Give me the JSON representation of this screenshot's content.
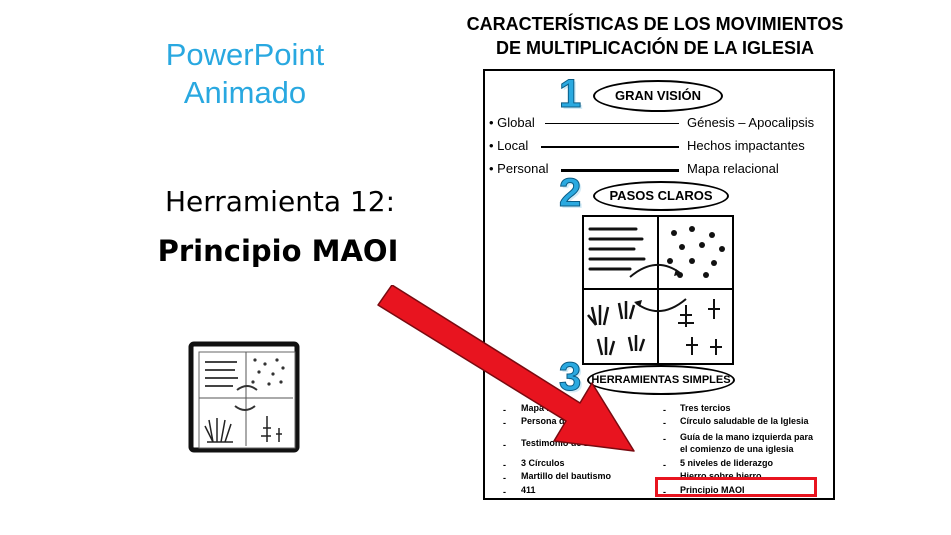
{
  "left": {
    "powerpoint_line1": "PowerPoint",
    "powerpoint_line2": "Animado",
    "tool_line": "Herramienta 12:",
    "principle_title": "Principio MAOI",
    "icon": "four-fields-icon"
  },
  "document": {
    "title_line1": "CARACTERÍSTICAS DE LOS MOVIMIENTOS",
    "title_line2": "DE MULTIPLICACIÓN DE LA IGLESIA",
    "sections": [
      {
        "number": "1",
        "heading": "GRAN VISIÓN"
      },
      {
        "number": "2",
        "heading": "PASOS CLAROS"
      },
      {
        "number": "3",
        "heading": "HERRAMIENTAS SIMPLES"
      }
    ],
    "vision_rows": [
      {
        "label": "• Global",
        "value": "Génesis – Apocalipsis"
      },
      {
        "label": "• Local",
        "value": "Hechos impactantes"
      },
      {
        "label": "• Personal",
        "value": "Mapa relacional"
      }
    ],
    "tools_left": [
      "Mapa re",
      "Persona de p",
      "Testimonio de 15 segu",
      "3 Círculos",
      "Martillo del bautismo",
      "411"
    ],
    "tools_right": [
      "Tres tercios",
      "Círculo saludable de la Iglesia",
      "Guía de la mano izquierda para",
      "el comienzo de una iglesia",
      "5 niveles de liderazgo",
      "Hierro sobre hierro",
      "Principio MAOI"
    ],
    "dash": "-"
  },
  "colors": {
    "accent_blue": "#29a8e0",
    "arrow_red": "#e8141f",
    "highlight_red": "#e8141f"
  },
  "icons": [
    "four-fields-icon",
    "red-arrow-icon",
    "cycle-arrows-icon"
  ]
}
